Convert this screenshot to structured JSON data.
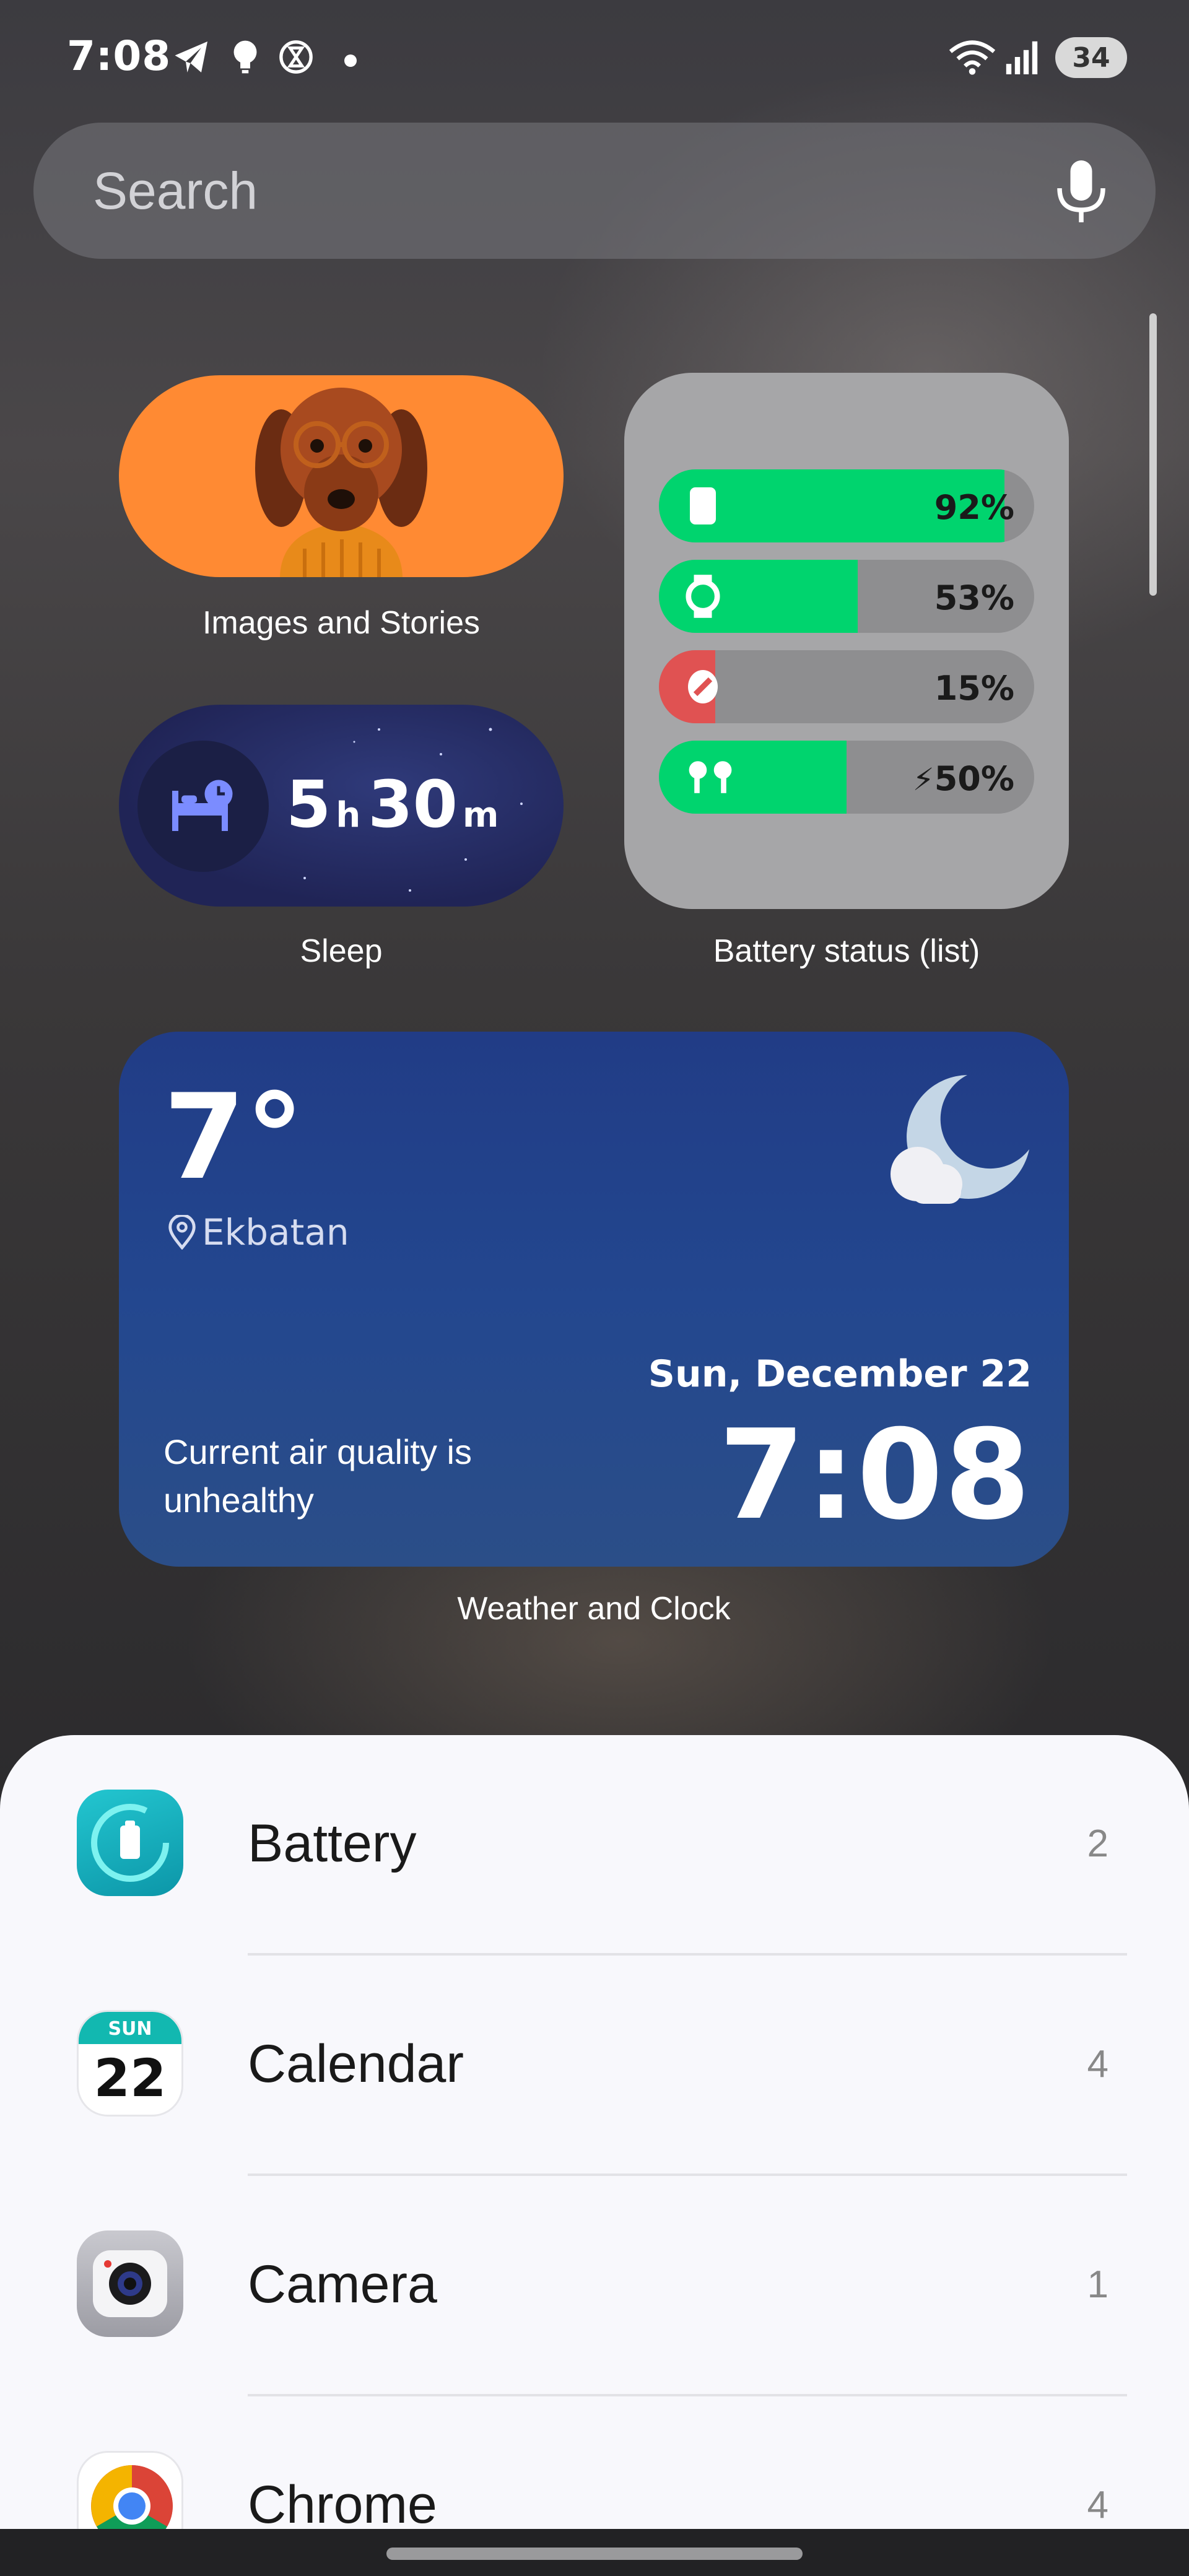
{
  "status_bar": {
    "time": "7:08",
    "battery": "34",
    "icons": [
      "telegram-icon",
      "bulb-icon",
      "hourglass-icon",
      "notification-dot",
      "wifi-icon",
      "signal-icon"
    ]
  },
  "search": {
    "placeholder": "Search",
    "mic_icon": "mic-icon"
  },
  "widgets": {
    "images_stories": {
      "label": "Images and Stories"
    },
    "sleep": {
      "hours": "5",
      "h_unit": "h",
      "minutes": "30",
      "m_unit": "m",
      "label": "Sleep"
    },
    "battery_list": {
      "label": "Battery status (list)",
      "items": [
        {
          "device": "phone",
          "percent": "92%",
          "level": 0.92,
          "color": "#00d46e",
          "icon": "phone-icon"
        },
        {
          "device": "watch",
          "percent": "53%",
          "level": 0.53,
          "color": "#00d46e",
          "icon": "watch-icon"
        },
        {
          "device": "earbud",
          "percent": "15%",
          "level": 0.15,
          "color": "#e05252",
          "icon": "earbud-icon"
        },
        {
          "device": "earbuds",
          "percent": "50%",
          "level": 0.5,
          "color": "#00d46e",
          "icon": "earbuds-icon",
          "charging": true
        }
      ]
    },
    "weather_clock": {
      "label": "Weather and Clock",
      "temperature": "7°",
      "location": "Ekbatan",
      "date": "Sun, December 22",
      "time": "7:08",
      "air_quality": "Current air quality is unhealthy"
    }
  },
  "apps": [
    {
      "name": "Battery",
      "count": "2",
      "icon": "battery-app-icon"
    },
    {
      "name": "Calendar",
      "count": "4",
      "icon": "calendar-app-icon",
      "icon_day": "SUN",
      "icon_date": "22"
    },
    {
      "name": "Camera",
      "count": "1",
      "icon": "camera-app-icon"
    },
    {
      "name": "Chrome",
      "count": "4",
      "icon": "chrome-app-icon"
    }
  ]
}
